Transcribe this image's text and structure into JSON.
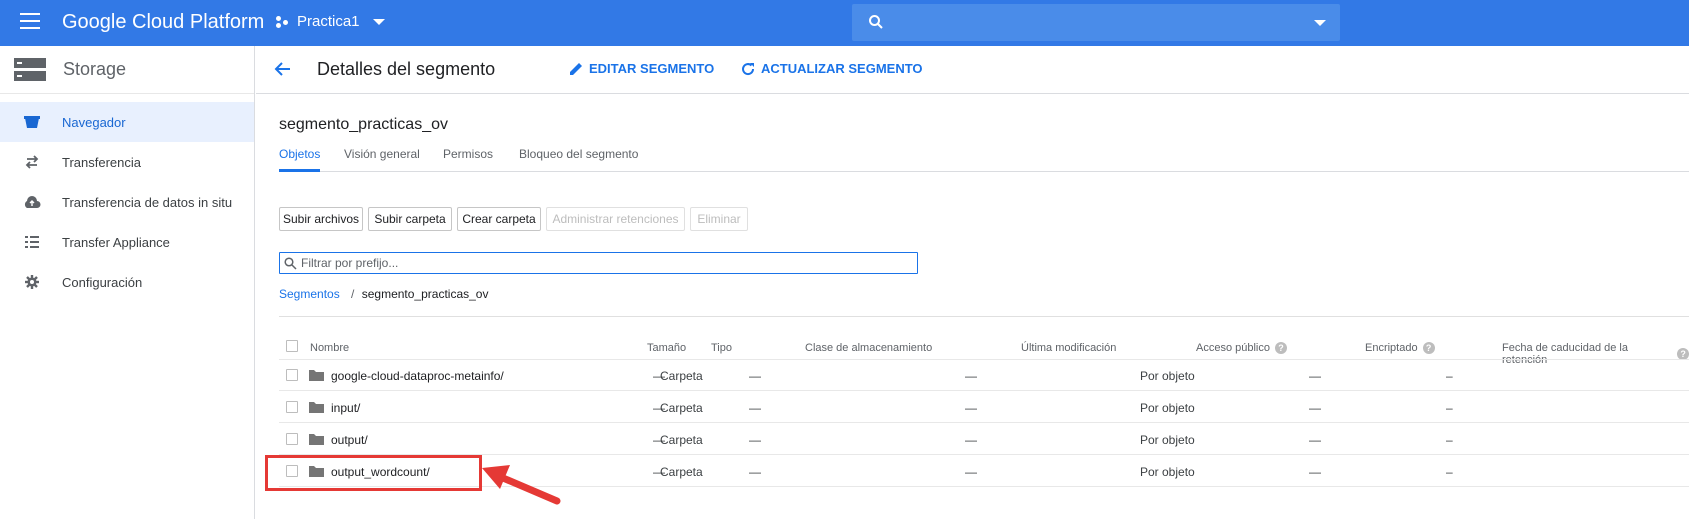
{
  "topbar": {
    "brand": "Google Cloud Platform",
    "project": "Practica1",
    "color": "#3279e6"
  },
  "sidebar": {
    "title": "Storage",
    "items": [
      {
        "label": "Navegador",
        "icon": "bucket-icon",
        "active": true
      },
      {
        "label": "Transferencia",
        "icon": "transfer-arrows-icon"
      },
      {
        "label": "Transferencia de datos in situ",
        "icon": "cloud-upload-icon"
      },
      {
        "label": "Transfer Appliance",
        "icon": "list-icon"
      },
      {
        "label": "Configuración",
        "icon": "gear-icon"
      }
    ]
  },
  "header": {
    "title": "Detalles del segmento",
    "edit_label": "EDITAR SEGMENTO",
    "refresh_label": "ACTUALIZAR SEGMENTO"
  },
  "bucket": {
    "name": "segmento_practicas_ov"
  },
  "tabs": [
    {
      "label": "Objetos",
      "active": true
    },
    {
      "label": "Visión general"
    },
    {
      "label": "Permisos"
    },
    {
      "label": "Bloqueo del segmento"
    }
  ],
  "buttons": {
    "upload_files": "Subir archivos",
    "upload_folder": "Subir carpeta",
    "create_folder": "Crear carpeta",
    "manage_holds": "Administrar retenciones",
    "delete": "Eliminar"
  },
  "filter": {
    "placeholder": "Filtrar por prefijo..."
  },
  "breadcrumb": {
    "root": "Segmentos",
    "separator": "/",
    "current": "segmento_practicas_ov"
  },
  "table": {
    "headers": {
      "name": "Nombre",
      "size": "Tamaño",
      "type": "Tipo",
      "storage_class": "Clase de almacenamiento",
      "modified": "Última modificación",
      "public": "Acceso público",
      "encryption": "Encriptado",
      "retention": "Fecha de caducidad de la retención"
    },
    "rows": [
      {
        "name": "google-cloud-dataproc-metainfo/",
        "size": "—",
        "type": "Carpeta",
        "storage_class": "—",
        "modified": "—",
        "public": "Por objeto",
        "encryption": "—",
        "retention": "–"
      },
      {
        "name": "input/",
        "size": "—",
        "type": "Carpeta",
        "storage_class": "—",
        "modified": "—",
        "public": "Por objeto",
        "encryption": "—",
        "retention": "–"
      },
      {
        "name": "output/",
        "size": "—",
        "type": "Carpeta",
        "storage_class": "—",
        "modified": "—",
        "public": "Por objeto",
        "encryption": "—",
        "retention": "–"
      },
      {
        "name": "output_wordcount/",
        "size": "—",
        "type": "Carpeta",
        "storage_class": "—",
        "modified": "—",
        "public": "Por objeto",
        "encryption": "—",
        "retention": "–"
      }
    ]
  },
  "annotation": {
    "color": "#e53935"
  }
}
